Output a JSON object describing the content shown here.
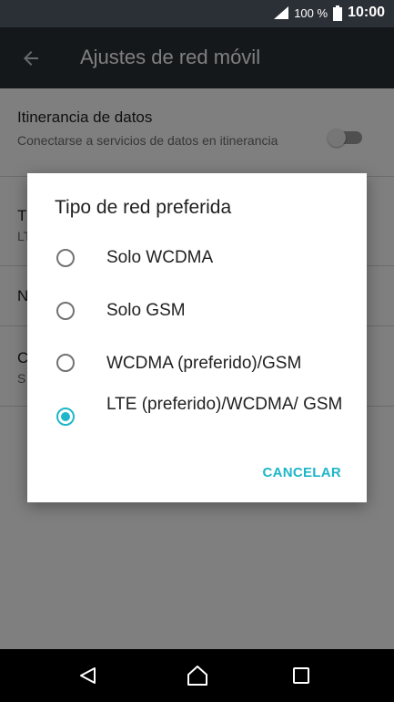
{
  "status_bar": {
    "battery_percent": "100 %",
    "time": "10:00"
  },
  "app_bar": {
    "title": "Ajustes de red móvil",
    "back_icon": "arrow-left-icon"
  },
  "settings": {
    "roaming": {
      "title": "Itinerancia de datos",
      "summary": "Conectarse a servicios de datos en itinerancia"
    },
    "row2": {
      "title": "T",
      "summary": "LT"
    },
    "row3": {
      "title": "N"
    },
    "row4": {
      "title": "C",
      "summary": "S"
    }
  },
  "dialog": {
    "title": "Tipo de red preferida",
    "options": [
      {
        "label": "Solo WCDMA",
        "selected": false
      },
      {
        "label": "Solo GSM",
        "selected": false
      },
      {
        "label": "WCDMA (preferido)/GSM",
        "selected": false
      },
      {
        "label": "LTE (preferido)/WCDMA/ GSM",
        "selected": true
      }
    ],
    "cancel_label": "CANCELAR"
  },
  "colors": {
    "accent": "#1fb6c9",
    "bar": "#2b3036"
  }
}
